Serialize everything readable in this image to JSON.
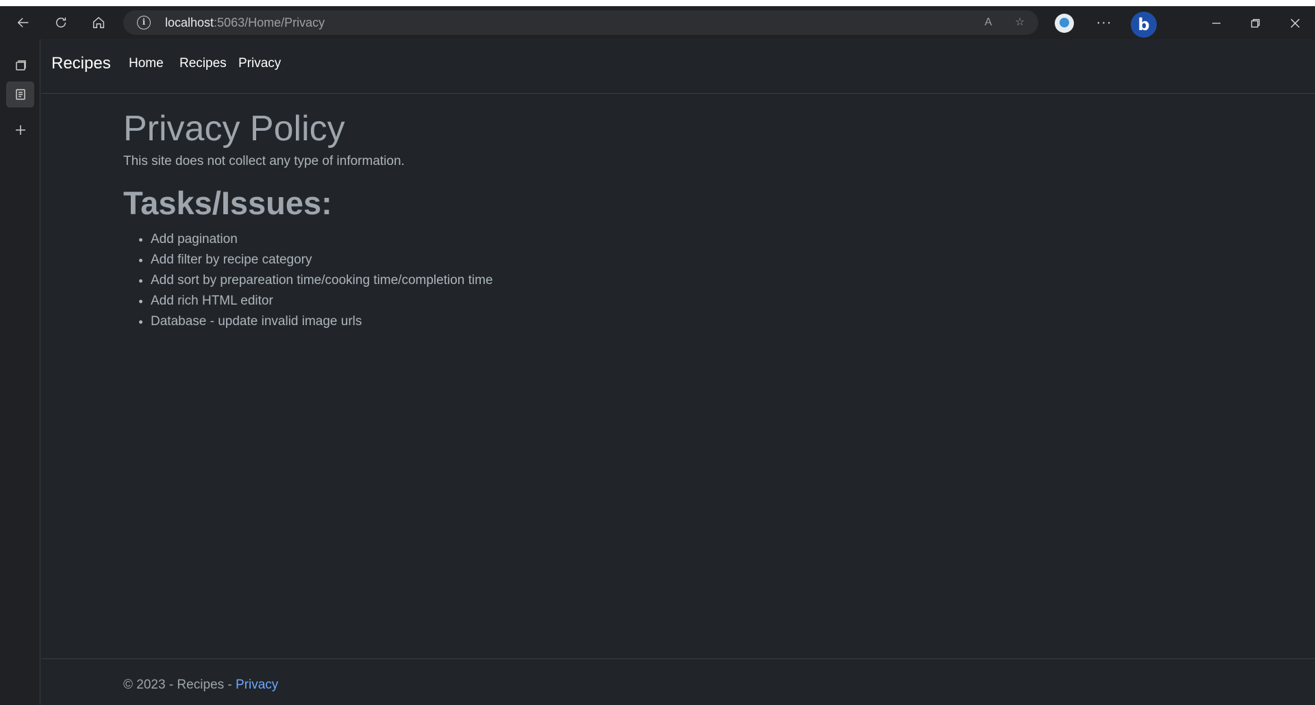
{
  "browser": {
    "url_host": "localhost",
    "url_path": ":5063/Home/Privacy",
    "nav_buttons": [
      "back-icon",
      "refresh-icon",
      "home-icon"
    ],
    "address_icons": [
      "read-aloud-icon",
      "add-favorite-icon"
    ],
    "more_label": "···",
    "copilot_label": "b"
  },
  "navbar": {
    "brand": "Recipes",
    "links": [
      "Home",
      "Recipes",
      "Privacy"
    ]
  },
  "main": {
    "title": "Privacy Policy",
    "intro": "This site does not collect any type of information.",
    "tasks_title": "Tasks/Issues:",
    "tasks": [
      "Add pagination",
      "Add filter by recipe category",
      "Add sort by prepareation time/cooking time/completion time",
      "Add rich HTML editor",
      "Database - update invalid image urls"
    ]
  },
  "footer": {
    "text": "© 2023 - Recipes - ",
    "link": "Privacy"
  },
  "colors": {
    "page_bg": "#212529",
    "text": "#adb5bd",
    "link": "#6ea8fe",
    "browser_bg": "#202124"
  }
}
